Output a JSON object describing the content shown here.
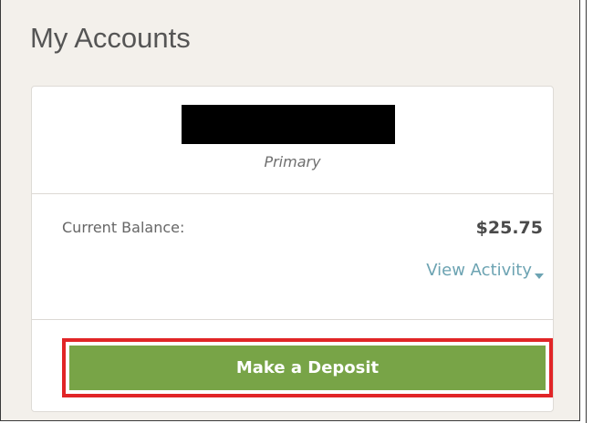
{
  "header": {
    "title": "My Accounts"
  },
  "account": {
    "name": "",
    "type": "Primary"
  },
  "balance": {
    "label": "Current Balance:",
    "value": "$25.75"
  },
  "activity": {
    "label": "View Activity",
    "icon": "caret-down-icon"
  },
  "actions": {
    "deposit_label": "Make a Deposit"
  },
  "colors": {
    "panel_background": "#f3f0eb",
    "card_background": "#ffffff",
    "title_text": "#555555",
    "activity_link": "#6ca3b2",
    "deposit_button": "#78a447",
    "highlight_outline": "#e12527"
  }
}
